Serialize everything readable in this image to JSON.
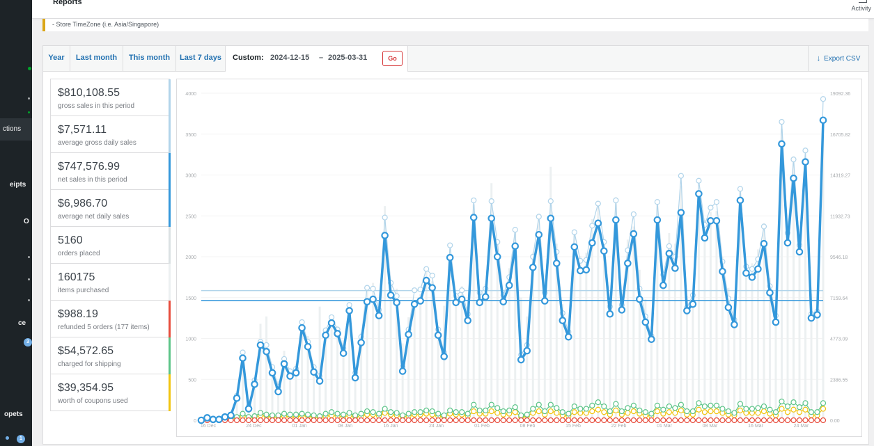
{
  "header": {
    "title": "Reports",
    "activity_label": "Activity"
  },
  "notice": {
    "text": "- Store TimeZone (i.e. Asia/Singapore)"
  },
  "sidebar": {
    "items": [
      {
        "label": "ctions",
        "top": 179
      },
      {
        "label": "eipts",
        "top": 259
      },
      {
        "label": "O",
        "top": 312
      },
      {
        "label": "ce",
        "top": 458
      },
      {
        "label": "opets",
        "top": 589
      }
    ],
    "badges": [
      "3",
      "1"
    ]
  },
  "tabs": {
    "year": "Year",
    "last_month": "Last month",
    "this_month": "This month",
    "last_7_days": "Last 7 days",
    "custom_label": "Custom:",
    "start_date": "2024-12-15",
    "separator": "–",
    "end_date": "2025-03-31",
    "go": "Go",
    "export": "Export CSV"
  },
  "colors": {
    "gross": "#b1d4ea",
    "net": "#3498db",
    "orders": "#dbe1e3",
    "items": "#ecf0f1",
    "refunds": "#e74c3c",
    "shipping": "#5cc488",
    "coupons": "#f1c40f"
  },
  "legend": [
    {
      "value": "$810,108.55",
      "label": "gross sales in this period",
      "color": "#b1d4ea"
    },
    {
      "value": "$7,571.11",
      "label": "average gross daily sales",
      "color": "#b1d4ea"
    },
    {
      "value": "$747,576.99",
      "label": "net sales in this period",
      "color": "#3498db"
    },
    {
      "value": "$6,986.70",
      "label": "average net daily sales",
      "color": "#3498db"
    },
    {
      "value": "5160",
      "label": "orders placed",
      "color": "#dbe1e3"
    },
    {
      "value": "160175",
      "label": "items purchased",
      "color": "#ecf0f1"
    },
    {
      "value": "$988.19",
      "label": "refunded 5 orders (177 items)",
      "color": "#e74c3c"
    },
    {
      "value": "$54,572.65",
      "label": "charged for shipping",
      "color": "#5cc488"
    },
    {
      "value": "$39,354.95",
      "label": "worth of coupons used",
      "color": "#f1c40f"
    }
  ],
  "chart_data": {
    "type": "line",
    "x_tick_labels": [
      "16 Dec",
      "24 Dec",
      "01 Jan",
      "08 Jan",
      "16 Jan",
      "24 Jan",
      "01 Feb",
      "08 Feb",
      "15 Feb",
      "22 Feb",
      "01 Mar",
      "08 Mar",
      "16 Mar",
      "24 Mar"
    ],
    "left_axis": {
      "ticks": [
        "0",
        "500",
        "1000",
        "1500",
        "2000",
        "2500",
        "3000",
        "3500",
        "4000"
      ],
      "ylim": [
        0,
        4000
      ]
    },
    "right_axis": {
      "ticks": [
        "0.00",
        "2386.55",
        "4773.09",
        "7159.64",
        "9546.18",
        "11932.73",
        "14319.27",
        "16705.82",
        "19092.36"
      ],
      "ylim": [
        0,
        19092.36
      ]
    },
    "average_lines": {
      "gross": 1586,
      "net": 1465
    },
    "net_sales": [
      0,
      30,
      10,
      10,
      40,
      60,
      270,
      760,
      140,
      440,
      920,
      840,
      580,
      350,
      690,
      540,
      580,
      1130,
      900,
      590,
      480,
      1040,
      1190,
      1060,
      820,
      1340,
      520,
      950,
      1450,
      1480,
      1280,
      2260,
      1530,
      1440,
      600,
      1050,
      1420,
      1460,
      1710,
      1620,
      1040,
      780,
      1990,
      1440,
      1480,
      1220,
      2480,
      1440,
      1510,
      2470,
      2000,
      1450,
      1650,
      2130,
      740,
      850,
      1870,
      2270,
      1460,
      2470,
      1920,
      1220,
      1020,
      2120,
      1830,
      1840,
      2170,
      2410,
      2070,
      1300,
      2450,
      1350,
      1920,
      2280,
      1480,
      1200,
      990,
      2450,
      1650,
      2040,
      1860,
      2540,
      1340,
      1420,
      2770,
      2230,
      2440,
      2440,
      1820,
      1380,
      1170,
      2690,
      1800,
      1750,
      1850,
      2160,
      1560,
      1200,
      3380,
      2170,
      2960,
      2060,
      3160,
      1250,
      1290,
      3670
    ],
    "gross_sales": [
      0,
      40,
      20,
      20,
      50,
      70,
      300,
      830,
      170,
      490,
      960,
      920,
      650,
      410,
      750,
      600,
      630,
      1200,
      960,
      650,
      540,
      1100,
      1260,
      1110,
      880,
      1410,
      580,
      1020,
      1620,
      1610,
      1350,
      2480,
      1680,
      1520,
      650,
      1110,
      1590,
      1600,
      1850,
      1770,
      1110,
      830,
      2140,
      1520,
      1590,
      1300,
      2690,
      1560,
      1610,
      2680,
      2180,
      1530,
      1750,
      2330,
      800,
      920,
      2000,
      2490,
      1560,
      2680,
      2060,
      1310,
      1080,
      2300,
      1950,
      1960,
      2380,
      2650,
      2180,
      1390,
      2690,
      1410,
      2080,
      2520,
      1610,
      1270,
      1030,
      2670,
      1780,
      2130,
      2000,
      2990,
      1380,
      1530,
      2930,
      2390,
      2600,
      2670,
      1940,
      1490,
      1230,
      2830,
      1880,
      1850,
      1970,
      2370,
      1640,
      1280,
      3650,
      2290,
      3190,
      2140,
      3300,
      1300,
      1330,
      3930
    ],
    "orders": [
      20,
      30,
      30,
      30,
      60,
      80,
      310,
      810,
      250,
      460,
      1180,
      1270,
      650,
      480,
      850,
      620,
      690,
      1200,
      1030,
      660,
      1390,
      1110,
      1240,
      1150,
      980,
      1430,
      600,
      1070,
      1620,
      1680,
      1380,
      2620,
      1700,
      1610,
      940,
      1260,
      1460,
      1540,
      1820,
      1700,
      1100,
      1400,
      2090,
      1540,
      1640,
      1390,
      2640,
      1590,
      1670,
      2900,
      2170,
      1490,
      1860,
      2350,
      1500,
      1270,
      2050,
      2530,
      1600,
      3100,
      2160,
      1420,
      1200,
      2320,
      2010,
      2050,
      2460,
      2620,
      2170,
      1490,
      2730,
      1550,
      2210,
      2370,
      1840,
      1480,
      1150,
      2630,
      1830,
      2290,
      2160,
      2870,
      1520,
      1530,
      2730,
      2450,
      2550,
      2560,
      2000,
      1620,
      1480,
      2810,
      1920,
      1920,
      2090,
      2410,
      1740,
      1420,
      3560,
      2160,
      3230,
      2140,
      3210,
      1550,
      1460,
      3490
    ],
    "shipping": [
      0,
      20,
      10,
      10,
      20,
      30,
      40,
      80,
      40,
      50,
      90,
      70,
      60,
      60,
      80,
      70,
      70,
      80,
      70,
      60,
      50,
      80,
      100,
      80,
      70,
      90,
      60,
      80,
      110,
      100,
      80,
      140,
      100,
      90,
      60,
      80,
      100,
      100,
      120,
      110,
      80,
      60,
      120,
      100,
      100,
      80,
      190,
      120,
      120,
      190,
      150,
      110,
      120,
      160,
      60,
      70,
      140,
      190,
      110,
      190,
      150,
      100,
      80,
      170,
      140,
      140,
      180,
      220,
      170,
      110,
      200,
      110,
      150,
      180,
      120,
      100,
      80,
      180,
      130,
      170,
      150,
      190,
      110,
      110,
      210,
      170,
      180,
      180,
      140,
      110,
      90,
      200,
      140,
      140,
      150,
      170,
      130,
      100,
      230,
      170,
      220,
      160,
      210,
      100,
      100,
      210
    ],
    "coupons": [
      0,
      10,
      10,
      10,
      20,
      20,
      30,
      50,
      30,
      40,
      60,
      50,
      40,
      40,
      50,
      40,
      40,
      60,
      50,
      40,
      30,
      50,
      60,
      50,
      40,
      60,
      40,
      50,
      70,
      70,
      50,
      90,
      70,
      60,
      40,
      50,
      70,
      70,
      80,
      70,
      50,
      40,
      80,
      70,
      70,
      50,
      110,
      80,
      80,
      110,
      90,
      70,
      80,
      100,
      40,
      50,
      90,
      110,
      70,
      110,
      90,
      60,
      50,
      100,
      90,
      90,
      110,
      130,
      100,
      70,
      120,
      70,
      90,
      110,
      80,
      60,
      50,
      110,
      80,
      100,
      90,
      120,
      70,
      70,
      130,
      100,
      110,
      110,
      90,
      70,
      60,
      120,
      90,
      90,
      90,
      110,
      80,
      60,
      140,
      100,
      130,
      100,
      130,
      60,
      60,
      140
    ],
    "refunds": [
      0,
      0,
      0,
      0,
      0,
      0,
      0,
      0,
      0,
      0,
      0,
      0,
      0,
      0,
      0,
      0,
      0,
      0,
      0,
      0,
      0,
      0,
      0,
      0,
      0,
      0,
      0,
      0,
      0,
      0,
      0,
      0,
      0,
      0,
      0,
      0,
      0,
      0,
      0,
      0,
      0,
      0,
      0,
      0,
      0,
      0,
      0,
      0,
      0,
      0,
      0,
      0,
      0,
      0,
      0,
      0,
      0,
      0,
      0,
      0,
      0,
      0,
      0,
      0,
      0,
      0,
      0,
      0,
      0,
      0,
      0,
      0,
      0,
      0,
      0,
      0,
      0,
      0,
      0,
      0,
      0,
      0,
      0,
      0,
      0,
      0,
      0,
      0,
      0,
      0,
      0,
      0,
      0,
      0,
      0,
      0,
      0,
      0,
      0,
      0,
      0,
      0,
      0,
      0,
      0,
      0
    ]
  }
}
